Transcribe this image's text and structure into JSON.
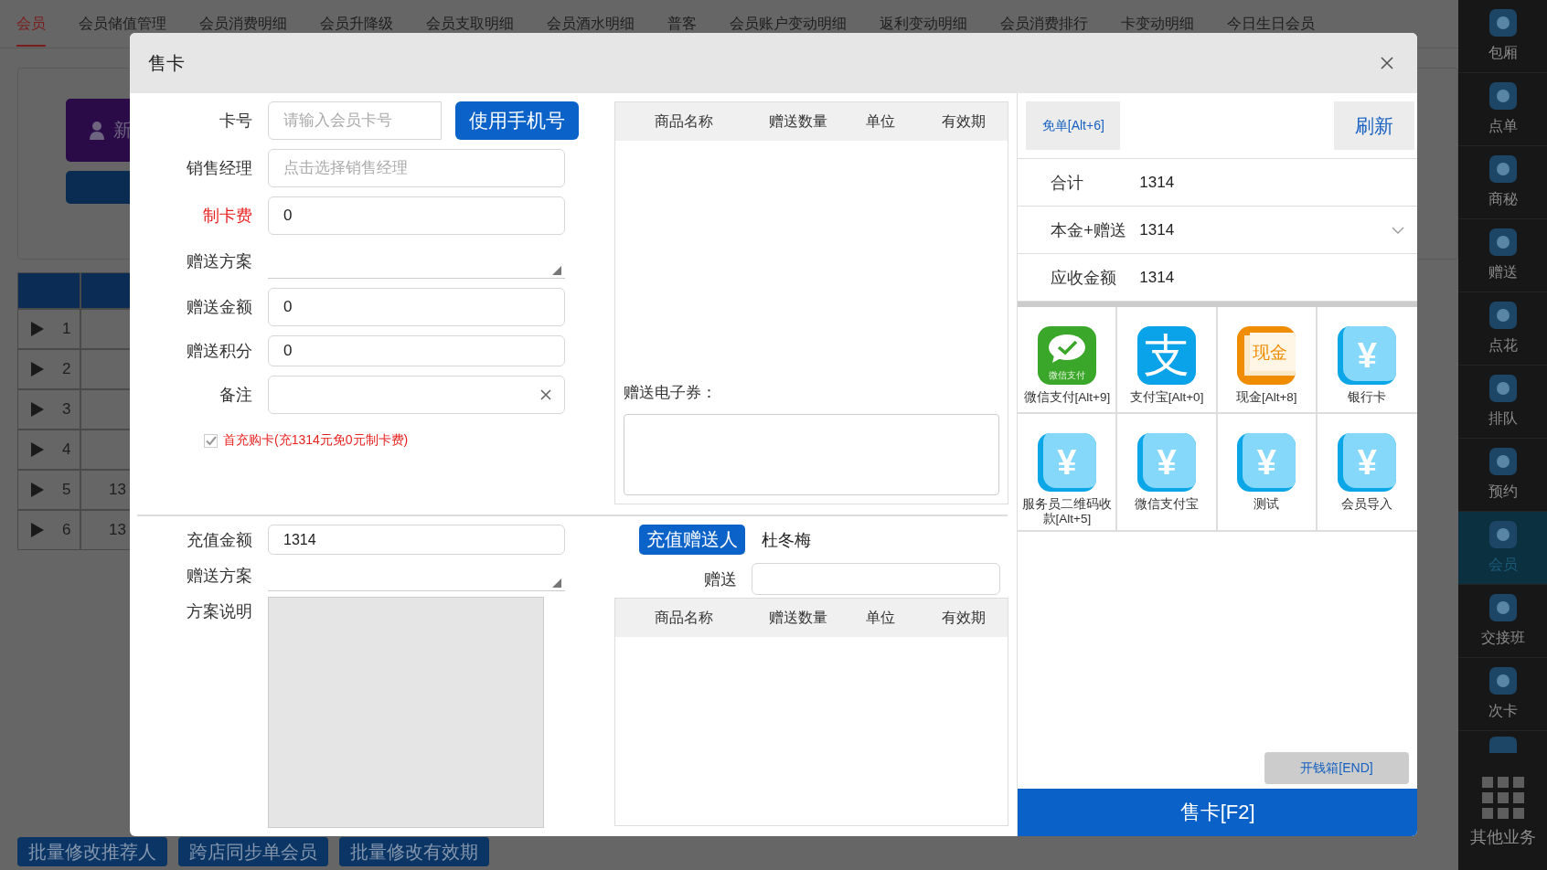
{
  "top_tabs": [
    {
      "label": "会员",
      "selected": true
    },
    {
      "label": "会员储值管理",
      "selected": false
    },
    {
      "label": "会员消费明细",
      "selected": false
    },
    {
      "label": "会员升降级",
      "selected": false
    },
    {
      "label": "会员支取明细",
      "selected": false
    },
    {
      "label": "会员酒水明细",
      "selected": false
    },
    {
      "label": "普客",
      "selected": false
    },
    {
      "label": "会员账户变动明细",
      "selected": false
    },
    {
      "label": "返利变动明细",
      "selected": false
    },
    {
      "label": "会员消费排行",
      "selected": false
    },
    {
      "label": "卡变动明细",
      "selected": false
    },
    {
      "label": "今日生日会员",
      "selected": false
    }
  ],
  "background": {
    "new_button": "新",
    "table_rows": [
      {
        "index": "1"
      },
      {
        "index": "2"
      },
      {
        "index": "3"
      },
      {
        "index": "4"
      },
      {
        "index": "5",
        "column_2": "13"
      },
      {
        "index": "6",
        "column_2": "13"
      }
    ],
    "bottom_buttons": [
      "批量修改推荐人",
      "跨店同步单会员",
      "批量修改有效期"
    ]
  },
  "sidebar": {
    "items": [
      {
        "label": "包厢",
        "selected": false
      },
      {
        "label": "点单",
        "selected": false
      },
      {
        "label": "商秘",
        "selected": false
      },
      {
        "label": "赠送",
        "selected": false
      },
      {
        "label": "点花",
        "selected": false
      },
      {
        "label": "排队",
        "selected": false
      },
      {
        "label": "预约",
        "selected": false
      },
      {
        "label": "会员",
        "selected": true
      },
      {
        "label": "交接班",
        "selected": false
      },
      {
        "label": "次卡",
        "selected": false
      }
    ],
    "more": "其他业务"
  },
  "dialog": {
    "title": "售卡",
    "card_form": [
      {
        "kind": "input",
        "label": "卡号",
        "placeholder": "请输入会员卡号",
        "button": "使用手机号"
      },
      {
        "kind": "input",
        "label": "销售经理",
        "placeholder": "点击选择销售经理"
      },
      {
        "kind": "input",
        "label": "制卡费",
        "value": "0",
        "highlight": true
      },
      {
        "kind": "select",
        "label": "赠送方案"
      },
      {
        "kind": "input",
        "label": "赠送金额",
        "value": "0"
      },
      {
        "kind": "input",
        "label": "赠送积分",
        "value": "0",
        "short": true
      },
      {
        "kind": "clearable",
        "label": "备注"
      }
    ],
    "first_charge": {
      "checked": true,
      "label": "首充购卡(充1314元免0元制卡费)"
    },
    "gift_goods": {
      "columns": [
        "商品名称",
        "赠送数量",
        "单位",
        "有效期"
      ],
      "coupon_label": "赠送电子券："
    },
    "recharge": {
      "amount_label": "充值金额",
      "amount": "1314",
      "plan_label": "赠送方案",
      "desc_label": "方案说明"
    },
    "gift_person": {
      "button": "充值赠送人",
      "name": "杜冬梅",
      "gift_label": "赠送",
      "columns": [
        "商品名称",
        "赠送数量",
        "单位",
        "有效期"
      ]
    },
    "summary": {
      "free_button": "免单[Alt+6]",
      "refresh_button": "刷新",
      "rows": [
        {
          "label": "合计",
          "value": "1314",
          "kind": "plain"
        },
        {
          "label": "本金+赠送",
          "value": "1314",
          "kind": "dropdown"
        },
        {
          "label": "应收金额",
          "value": "1314",
          "kind": "plain"
        }
      ]
    },
    "payments": [
      {
        "label": "微信支付[Alt+9]",
        "kind": "wechat",
        "badge_text": "微信支付"
      },
      {
        "label": "支付宝[Alt+0]",
        "kind": "alipay",
        "badge_text": "支"
      },
      {
        "label": "现金[Alt+8]",
        "kind": "cash",
        "badge_text": "现金"
      },
      {
        "label": "银行卡",
        "kind": "yen",
        "badge_text": "¥"
      },
      {
        "label": "服务员二维码收款[Alt+5]",
        "kind": "yen",
        "badge_text": "¥"
      },
      {
        "label": "微信支付宝",
        "kind": "yen",
        "badge_text": "¥"
      },
      {
        "label": "测试",
        "kind": "yen",
        "badge_text": "¥"
      },
      {
        "label": "会员导入",
        "kind": "yen",
        "badge_text": "¥"
      }
    ],
    "cash_drawer_button": "开钱箱[END]",
    "sell_button": "售卡[F2]"
  }
}
